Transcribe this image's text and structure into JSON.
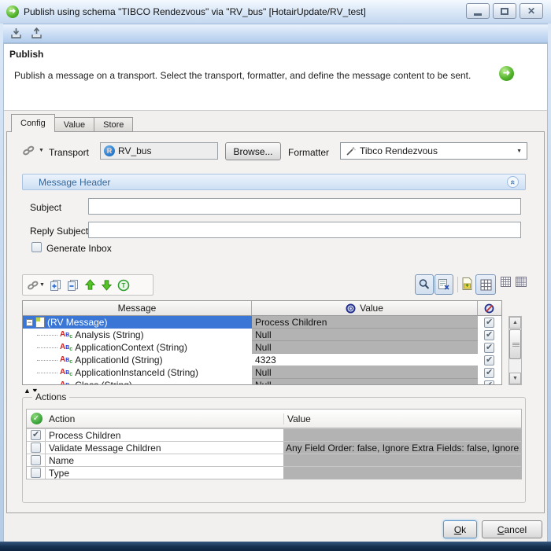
{
  "window": {
    "title": "Publish using schema \"TIBCO Rendezvous\" via \"RV_bus\" [HotairUpdate/RV_test]",
    "close_glyph": "✕"
  },
  "header": {
    "title": "Publish",
    "description": "Publish a message on a transport. Select the transport, formatter, and define the message content to be sent."
  },
  "tabs": [
    {
      "label": "Config",
      "active": true
    },
    {
      "label": "Value",
      "active": false
    },
    {
      "label": "Store",
      "active": false
    }
  ],
  "config": {
    "transport_label": "Transport",
    "transport_value": "RV_bus",
    "browse_label": "Browse...",
    "formatter_label": "Formatter",
    "formatter_value": "Tibco Rendezvous"
  },
  "message_header": {
    "title": "Message Header",
    "subject_label": "Subject",
    "subject_value": "",
    "reply_subject_label": "Reply Subject",
    "reply_subject_value": "",
    "generate_inbox_label": "Generate Inbox",
    "generate_inbox_checked": false
  },
  "message_table": {
    "columns": {
      "message": "Message",
      "value": "Value"
    },
    "rows": [
      {
        "label": "(RV Message)",
        "value": "Process Children",
        "root": true,
        "selected": true,
        "editable": false,
        "checked": true
      },
      {
        "label": "Analysis (String)",
        "value": "Null",
        "root": false,
        "selected": false,
        "editable": false,
        "checked": true
      },
      {
        "label": "ApplicationContext (String)",
        "value": "Null",
        "root": false,
        "selected": false,
        "editable": false,
        "checked": true
      },
      {
        "label": "ApplicationId (String)",
        "value": "4323",
        "root": false,
        "selected": false,
        "editable": true,
        "checked": true
      },
      {
        "label": "ApplicationInstanceId (String)",
        "value": "Null",
        "root": false,
        "selected": false,
        "editable": false,
        "checked": true
      },
      {
        "label": "Class (String)",
        "value": "Null",
        "root": false,
        "selected": false,
        "editable": false,
        "checked": true
      }
    ]
  },
  "actions": {
    "title": "Actions",
    "columns": {
      "action": "Action",
      "value": "Value"
    },
    "rows": [
      {
        "label": "Process Children",
        "value": "",
        "checked": true
      },
      {
        "label": "Validate Message Children",
        "value": "Any Field Order: false, Ignore Extra Fields: false, Ignore N",
        "checked": false
      },
      {
        "label": "Name",
        "value": "",
        "checked": false
      },
      {
        "label": "Type",
        "value": "",
        "checked": false
      }
    ]
  },
  "footer": {
    "ok_label": "Ok",
    "cancel_label": "Cancel"
  },
  "icons": {
    "titlebar": [
      "minimize-icon",
      "maximize-icon",
      "close-icon"
    ],
    "top_toolbar": [
      "import-icon",
      "export-icon"
    ],
    "transport_prefix": "link-icon",
    "transport_field": "rendezvous-icon",
    "formatter_field": "wand-icon",
    "message_header_collapse": "chevron-up-icon",
    "message_toolbar_left": [
      "link-icon",
      "add-node-icon",
      "remove-node-icon",
      "move-up-icon",
      "move-down-icon",
      "type-icon"
    ],
    "message_toolbar_right": [
      "zoom-icon",
      "filter-columns-icon",
      "document-icon",
      "grid-large-icon",
      "grid-medium-icon",
      "grid-small-icon"
    ],
    "value_column_icon": "globe-icon",
    "readonly_column_icon": "no-edit-icon",
    "actions_header_icon": "check-circle-icon"
  },
  "colors": {
    "selection": "#3a76d6",
    "value_cell_gray": "#b3b3b3",
    "titlebar_blue": "#c3d7ef",
    "message_header_text": "#35679a",
    "frame_bottom_navy": "#15304f"
  }
}
